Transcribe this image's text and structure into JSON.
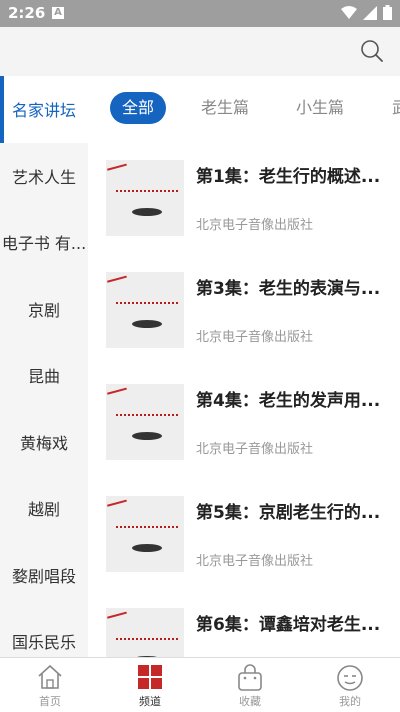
{
  "status": {
    "time": "2:26",
    "a_label": "A"
  },
  "sidebar": {
    "items": [
      {
        "label": "名家讲坛",
        "active": true
      },
      {
        "label": "艺术人生"
      },
      {
        "label": "电子书 有..."
      },
      {
        "label": "京剧"
      },
      {
        "label": "昆曲"
      },
      {
        "label": "黄梅戏"
      },
      {
        "label": "越剧"
      },
      {
        "label": "婺剧唱段"
      },
      {
        "label": "国乐民乐"
      }
    ]
  },
  "tabs": [
    {
      "label": "全部",
      "active": true
    },
    {
      "label": "老生篇"
    },
    {
      "label": "小生篇"
    },
    {
      "label": "武"
    }
  ],
  "list": [
    {
      "title": "第1集：老生行的概述...",
      "publisher": "北京电子音像出版社"
    },
    {
      "title": "第3集：老生的表演与...",
      "publisher": "北京电子音像出版社"
    },
    {
      "title": "第4集：老生的发声用...",
      "publisher": "北京电子音像出版社"
    },
    {
      "title": "第5集：京剧老生行的...",
      "publisher": "北京电子音像出版社"
    },
    {
      "title": "第6集：谭鑫培对老生...",
      "publisher": ""
    }
  ],
  "bottom_nav": [
    {
      "label": "首页",
      "icon": "home-icon"
    },
    {
      "label": "频道",
      "icon": "channel-grid-icon",
      "active": true
    },
    {
      "label": "收藏",
      "icon": "bag-icon"
    },
    {
      "label": "我的",
      "icon": "face-icon"
    }
  ],
  "colors": {
    "accent": "#1565c0",
    "brand_red": "#c62828"
  }
}
